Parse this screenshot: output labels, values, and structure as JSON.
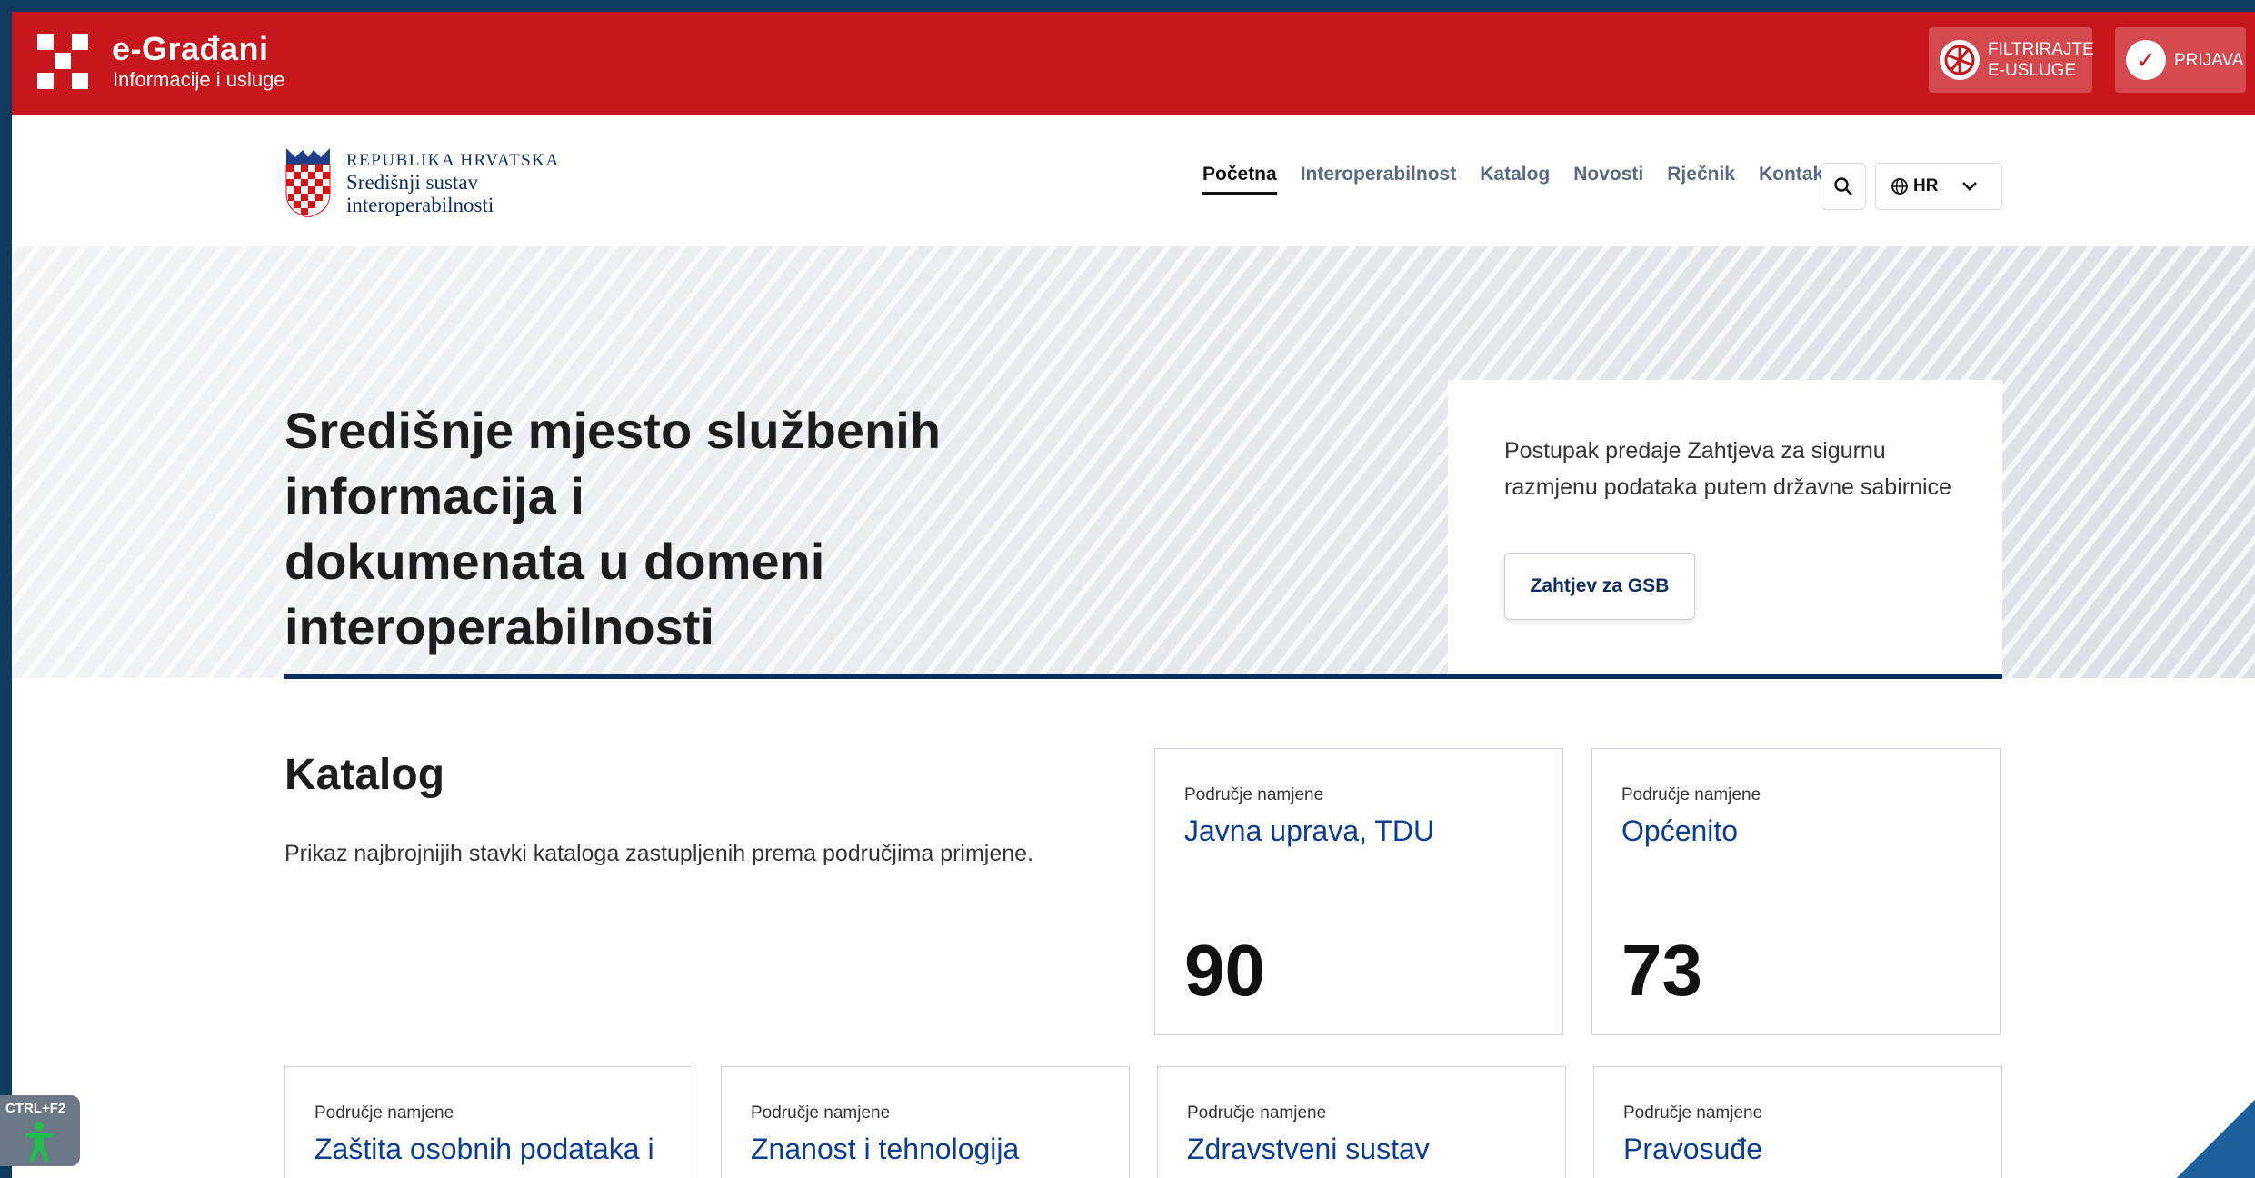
{
  "egov": {
    "title": "e-Građani",
    "subtitle": "Informacije i usluge",
    "filter_label_1": "FILTRIRAJTE",
    "filter_label_2": "E-USLUGE",
    "login_label": "PRIJAVA"
  },
  "header": {
    "brand_line1": "REPUBLIKA HRVATSKA",
    "brand_line2": "Središnji sustav",
    "brand_line3": "interoperabilnosti",
    "nav": [
      "Početna",
      "Interoperabilnost",
      "Katalog",
      "Novosti",
      "Rječnik",
      "Kontakt"
    ],
    "active_nav": "Početna",
    "language": "HR"
  },
  "hero": {
    "heading_line1": "Središnje mjesto službenih informacija i",
    "heading_line2": "dokumenata u domeni interoperabilnosti",
    "card_text": "Postupak predaje Zahtjeva za sigurnu razmjenu podataka putem državne sabirnice",
    "card_button": "Zahtjev za GSB"
  },
  "catalog": {
    "title": "Katalog",
    "description": "Prikaz najbrojnijih stavki kataloga zastupljenih prema područjima primjene.",
    "cards": [
      {
        "kicker": "Područje namjene",
        "title": "Javna uprava, TDU",
        "count": "90"
      },
      {
        "kicker": "Područje namjene",
        "title": "Općenito",
        "count": "73"
      },
      {
        "kicker": "Područje namjene",
        "title": "Zaštita osobnih podataka i"
      },
      {
        "kicker": "Područje namjene",
        "title": "Znanost i tehnologija"
      },
      {
        "kicker": "Područje namjene",
        "title": "Zdravstveni sustav"
      },
      {
        "kicker": "Područje namjene",
        "title": "Pravosuđe"
      }
    ]
  },
  "accessibility": {
    "shortcut": "CTRL+F2"
  },
  "colors": {
    "egov_red": "#c8161d",
    "brand_blue": "#0b2d5e",
    "link_blue": "#0b3d91"
  }
}
